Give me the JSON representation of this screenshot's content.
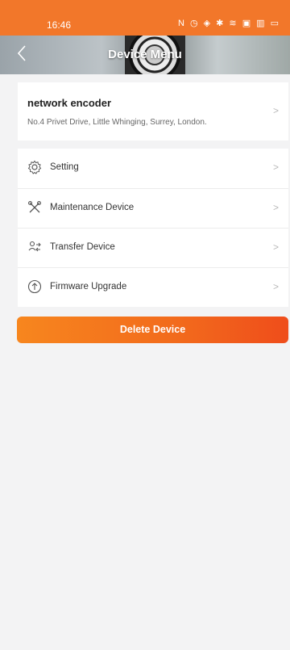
{
  "status_bar": {
    "time": "16:46",
    "icons_text": "N ◷ ◈ ✱ ≋ ▣ ▥ ▭"
  },
  "header": {
    "title": "Device Menu",
    "back_icon": "chevron-left-icon"
  },
  "device": {
    "name": "network encoder",
    "address": "No.4 Privet Drive, Little Whinging, Surrey, London."
  },
  "menu": {
    "items": [
      {
        "label": "Setting",
        "icon": "gear-icon"
      },
      {
        "label": "Maintenance Device",
        "icon": "tools-icon"
      },
      {
        "label": "Transfer Device",
        "icon": "transfer-icon"
      },
      {
        "label": "Firmware Upgrade",
        "icon": "upgrade-icon"
      }
    ]
  },
  "actions": {
    "delete_label": "Delete Device"
  },
  "colors": {
    "accent": "#f2772a",
    "button_gradient_start": "#f7861e",
    "button_gradient_end": "#ef4d1b",
    "background": "#f3f3f4"
  }
}
